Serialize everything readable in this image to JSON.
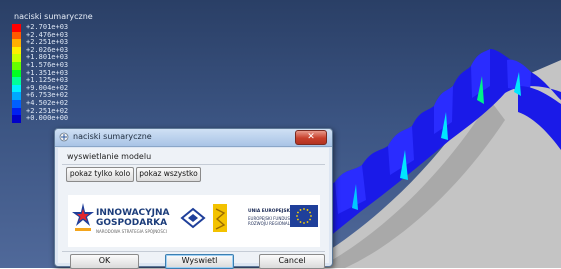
{
  "legend": {
    "title": "naciski sumaryczne",
    "entries": [
      {
        "value": "+2.701e+03",
        "color": "#ff0000"
      },
      {
        "value": "+2.476e+03",
        "color": "#ff5a00"
      },
      {
        "value": "+2.251e+03",
        "color": "#ffae00"
      },
      {
        "value": "+2.026e+03",
        "color": "#ffee00"
      },
      {
        "value": "+1.801e+03",
        "color": "#c8ff00"
      },
      {
        "value": "+1.576e+03",
        "color": "#66ff00"
      },
      {
        "value": "+1.351e+03",
        "color": "#00ff22"
      },
      {
        "value": "+1.125e+03",
        "color": "#00ff9a"
      },
      {
        "value": "+9.004e+02",
        "color": "#00f0ff"
      },
      {
        "value": "+6.753e+02",
        "color": "#00a8ff"
      },
      {
        "value": "+4.502e+02",
        "color": "#0060ff"
      },
      {
        "value": "+2.251e+02",
        "color": "#0020f0"
      },
      {
        "value": "+0.000e+00",
        "color": "#0000c8"
      }
    ]
  },
  "dialog": {
    "title": "naciski sumaryczne",
    "close_symbol": "✕",
    "section_label": "wyswietlanie modelu",
    "buttons": {
      "show_wheel": "pokaz tylko kolo",
      "show_all": "pokaz wszystko",
      "ok": "OK",
      "display": "Wyswietl",
      "cancel": "Cancel"
    },
    "logos": {
      "innovation_line1": "INNOWACYJNA",
      "innovation_line2": "GOSPODARKA",
      "innovation_line3": "NARODOWA STRATEGIA SPÓJNOŚCI",
      "eu_line1": "UNIA EUROPEJSKA",
      "eu_line2": "EUROPEJSKI FUNDUSZ",
      "eu_line3": "ROZWOJU REGIONALNEGO"
    }
  },
  "icons": {
    "app": "abaqus-app-icon",
    "close": "close-icon",
    "innovation_logo": "innowacyjna-gospodarka-logo",
    "university_logo": "university-logo",
    "eu_flag": "eu-flag-icon"
  },
  "colors": {
    "viewport_bg": "#3b5482",
    "gear_blue": "#1a1ae8",
    "gear_body": "#bfbfbf",
    "eu_blue": "#1f3f9a",
    "eu_star": "#ffd500"
  }
}
